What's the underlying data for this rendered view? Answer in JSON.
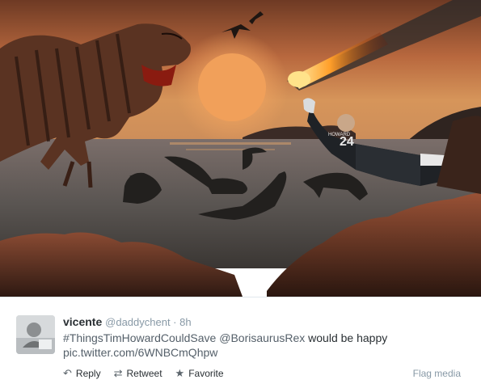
{
  "tweet": {
    "display_name": "vicente",
    "screen_name": "@daddychent",
    "separator": " · ",
    "timestamp": "8h",
    "hashtag": "#ThingsTimHowardCouldSave",
    "mention": "@BorisaurusRex",
    "text_rest": " would be happy",
    "link": "pic.twitter.com/6WNBCmQhpw"
  },
  "actions": {
    "reply_label": "Reply",
    "retweet_label": "Retweet",
    "favorite_label": "Favorite",
    "flag_label": "Flag media"
  },
  "media": {
    "jersey_number": "24",
    "jersey_name": "HOWARD"
  },
  "icons": {
    "reply": "reply-icon",
    "retweet": "retweet-icon",
    "favorite": "star-icon"
  },
  "colors": {
    "link": "#55606a",
    "muted": "#8899a6",
    "text": "#292f33"
  }
}
